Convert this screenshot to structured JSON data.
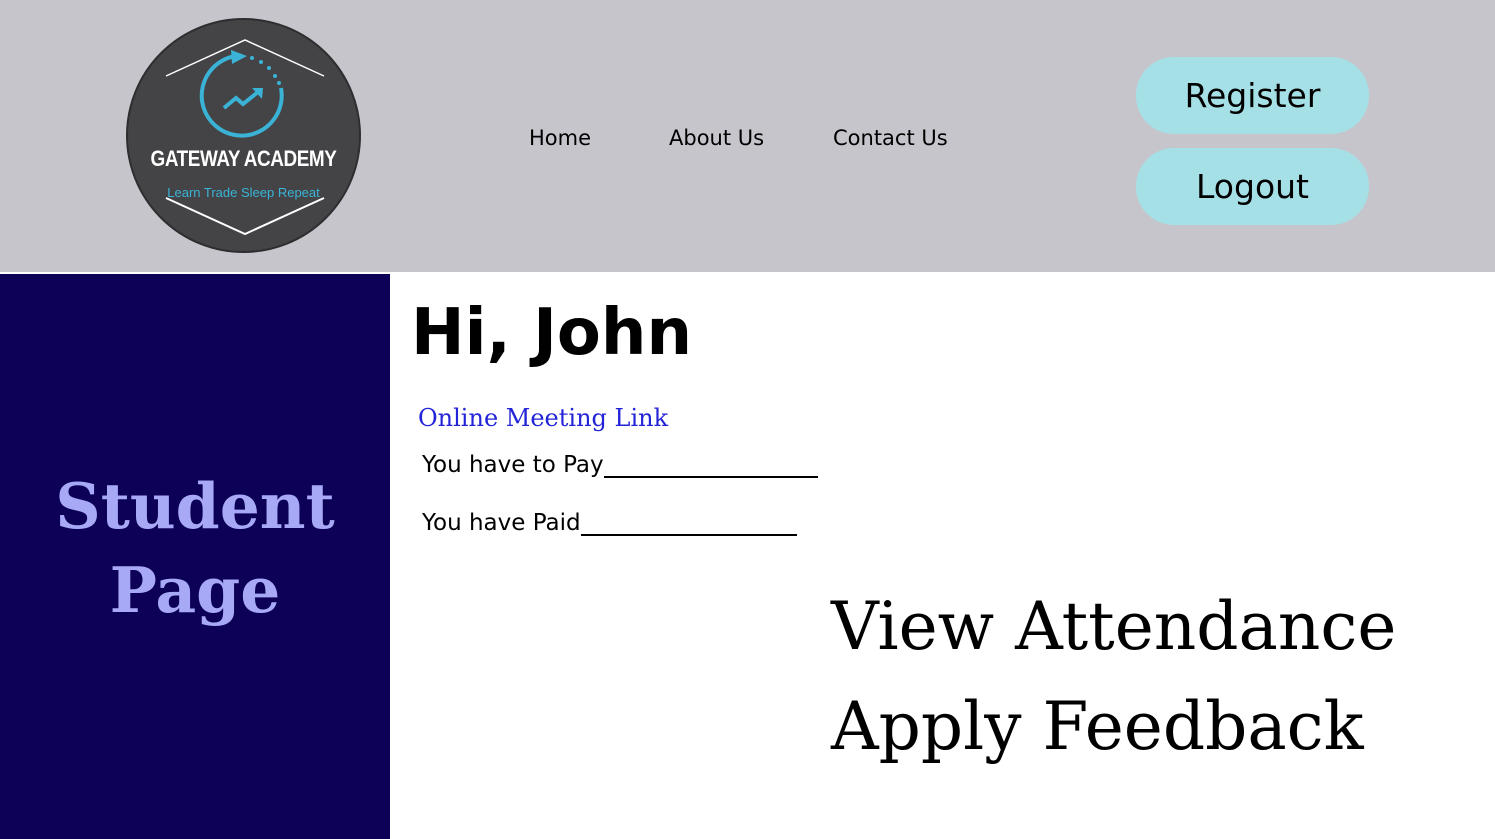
{
  "colors": {
    "header_bg": "#c6c5cb",
    "sidebar_bg": "#0d0057",
    "sidebar_text": "#a7a9f6",
    "button_bg": "#a6e0e7",
    "link": "#2323d8",
    "logo_bg": "#444446",
    "logo_accent": "#3ab3d6"
  },
  "logo": {
    "icon": "trending-up-arrow-icon",
    "title": "GATEWAY ACADEMY",
    "tagline": "Learn Trade Sleep Repeat"
  },
  "nav": {
    "items": [
      {
        "label": "Home"
      },
      {
        "label": "About Us"
      },
      {
        "label": "Contact Us"
      }
    ]
  },
  "auth": {
    "register_label": "Register",
    "logout_label": "Logout"
  },
  "sidebar": {
    "title": "Student Page"
  },
  "main": {
    "greeting": "Hi, John",
    "meeting_link": "Online Meeting Link",
    "to_pay_label": "You have to Pay",
    "paid_label": "You have Paid",
    "actions": [
      {
        "label": "View Attendance"
      },
      {
        "label": "Apply Feedback"
      }
    ]
  }
}
